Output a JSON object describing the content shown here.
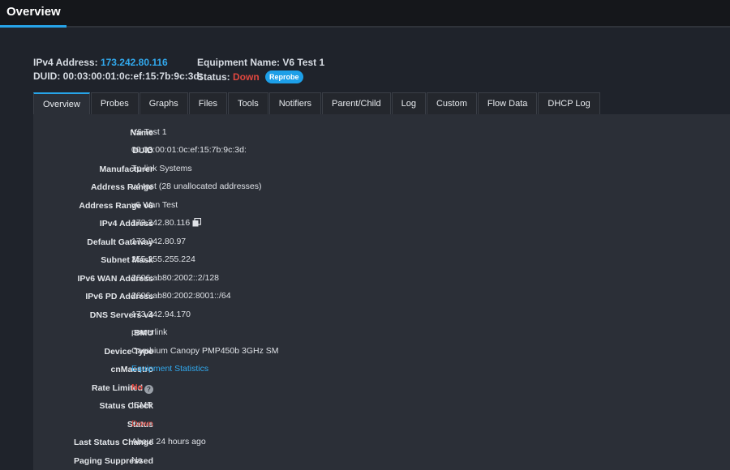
{
  "app": {
    "title": "Overview"
  },
  "header": {
    "ipv4_label": "IPv4 Address:",
    "ipv4_value": "173.242.80.116",
    "duid_label": "DUID:",
    "duid_value": "00:03:00:01:0c:ef:15:7b:9c:3d:",
    "equipment_label": "Equipment Name:",
    "equipment_value": "V6 Test 1",
    "status_label": "Status:",
    "status_value": "Down",
    "reprobe_label": "Reprobe"
  },
  "tabs": [
    "Overview",
    "Probes",
    "Graphs",
    "Files",
    "Tools",
    "Notifiers",
    "Parent/Child",
    "Log",
    "Custom",
    "Flow Data",
    "DHCP Log"
  ],
  "details": [
    {
      "label": "Name",
      "value": "V6 Test 1"
    },
    {
      "label": "DUID",
      "value": "00:03:00:01:0c:ef:15:7b:9c:3d:"
    },
    {
      "label": "Manufacturer",
      "value": "Tp-link Systems"
    },
    {
      "label": "Address Range",
      "value": "v4 test (28 unallocated addresses)"
    },
    {
      "label": "Address Range v6",
      "value": "v6 Wan Test"
    },
    {
      "label": "IPv4 Address",
      "value": "173.242.80.116"
    },
    {
      "label": "Default Gateway",
      "value": "173.242.80.97"
    },
    {
      "label": "Subnet Mask",
      "value": "255.255.255.224"
    },
    {
      "label": "IPv6 WAN Address",
      "value": "2606:ab80:2002::2/128"
    },
    {
      "label": "IPv6 PD Address",
      "value": "2606:ab80:2002:8001::/64"
    },
    {
      "label": "DNS Servers v4",
      "value": "173.242.94.170"
    },
    {
      "label": "BMU",
      "value": "powerlink"
    },
    {
      "label": "Device Type",
      "value": "Cambium Canopy PMP450b 3GHz SM"
    },
    {
      "label": "cnMaestro",
      "value": "Equipment Statistics"
    },
    {
      "label": "Rate Limited",
      "value": "No"
    },
    {
      "label": "Status Check",
      "value": "ICMP"
    },
    {
      "label": "Status",
      "value": "Down"
    },
    {
      "label": "Last Status Change",
      "value": "About 24 hours ago"
    },
    {
      "label": "Paging Suppressed",
      "value": "No"
    }
  ],
  "colors": {
    "accent": "#27a4e8",
    "down": "#e0473f",
    "background": "#1f232b",
    "panel": "#2b2f37"
  }
}
